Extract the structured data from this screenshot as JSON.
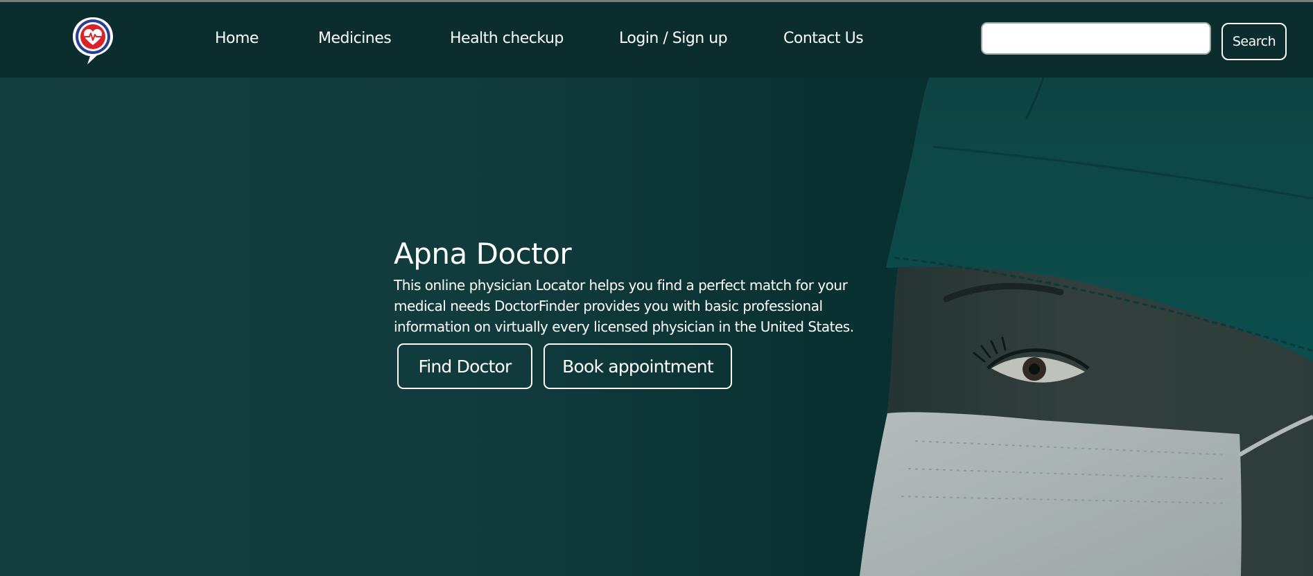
{
  "nav": {
    "logo_icon": "heart-pulse-chat-bubble-icon",
    "items": [
      {
        "label": "Home"
      },
      {
        "label": "Medicines"
      },
      {
        "label": "Health checkup"
      },
      {
        "label": "Login / Sign up"
      },
      {
        "label": "Contact Us"
      }
    ],
    "search": {
      "value": "",
      "placeholder": "",
      "button_label": "Search"
    }
  },
  "hero": {
    "title": "Apna Doctor",
    "description": "This online physician Locator helps you find a perfect match for your medical needs DoctorFinder provides you with basic professional information on virtually every licensed physician in the United States.",
    "buttons": [
      {
        "label": "Find Doctor"
      },
      {
        "label": "Book appointment"
      }
    ]
  },
  "colors": {
    "navbar_bg": "#0b2d2e",
    "hero_bg": "#113c3d",
    "logo_red": "#d8232a",
    "logo_blue": "#2a3f8f",
    "text": "#ffffff"
  }
}
